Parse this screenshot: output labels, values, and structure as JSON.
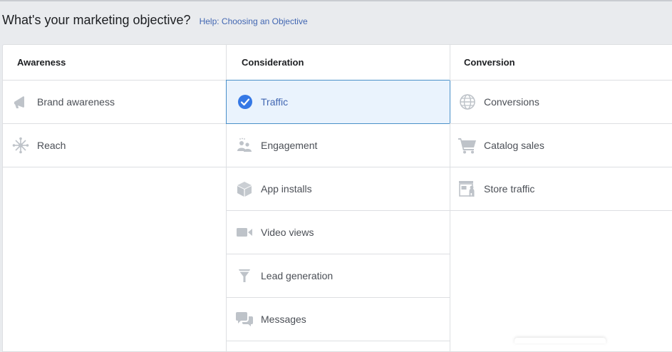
{
  "header": {
    "title": "What's your marketing objective?",
    "help_link": "Help: Choosing an Objective"
  },
  "columns": [
    {
      "title": "Awareness",
      "items": [
        {
          "label": "Brand awareness",
          "icon": "megaphone-icon"
        },
        {
          "label": "Reach",
          "icon": "reach-icon"
        }
      ]
    },
    {
      "title": "Consideration",
      "items": [
        {
          "label": "Traffic",
          "icon": "checkmark-circle-icon",
          "selected": true
        },
        {
          "label": "Engagement",
          "icon": "people-icon"
        },
        {
          "label": "App installs",
          "icon": "box-icon"
        },
        {
          "label": "Video views",
          "icon": "video-camera-icon"
        },
        {
          "label": "Lead generation",
          "icon": "funnel-icon"
        },
        {
          "label": "Messages",
          "icon": "chat-bubbles-icon"
        }
      ]
    },
    {
      "title": "Conversion",
      "items": [
        {
          "label": "Conversions",
          "icon": "globe-icon"
        },
        {
          "label": "Catalog sales",
          "icon": "shopping-cart-icon"
        },
        {
          "label": "Store traffic",
          "icon": "store-icon"
        }
      ]
    }
  ],
  "colors": {
    "accent": "#4267b2",
    "selected_bg": "#eaf3fd",
    "selected_border": "#4a90c9",
    "check": "#1877f2",
    "icon_gray": "#bec3c9"
  }
}
